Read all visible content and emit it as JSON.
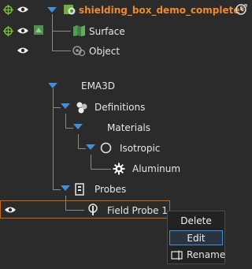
{
  "tree": {
    "root_label": "shielding_box_demo_complete*",
    "surface_label": "Surface",
    "object_label": "Object",
    "ema_label": "EMA3D",
    "definitions_label": "Definitions",
    "materials_label": "Materials",
    "isotropic_label": "Isotropic",
    "aluminum_label": "Aluminum",
    "probes_label": "Probes",
    "field_probe_label": "Field Probe 1"
  },
  "context_menu": {
    "delete_label": "Delete",
    "edit_label": "Edit",
    "rename_label": "Rename"
  },
  "colors": {
    "accent_orange": "#f08a2a",
    "expand_blue": "#3f8fe0",
    "visible_green": "#7fbf3f",
    "background": "#2b2b2b"
  }
}
